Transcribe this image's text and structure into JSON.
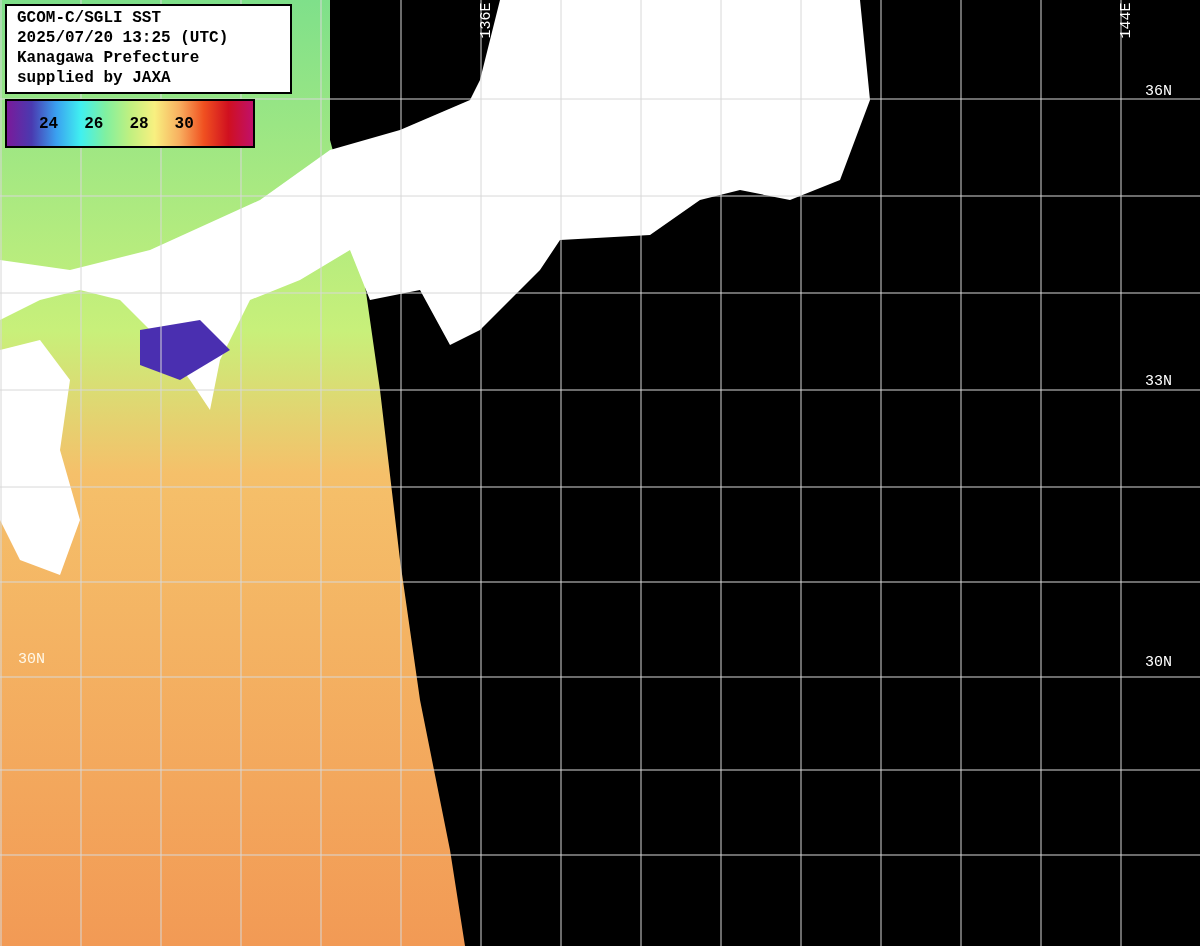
{
  "info_box": {
    "lines": [
      "GCOM-C/SGLI SST",
      "2025/07/20 13:25 (UTC)",
      "Kanagawa Prefecture",
      "supplied by JAXA"
    ]
  },
  "color_scale": {
    "labels": [
      "24",
      "26",
      "28",
      "30"
    ]
  },
  "longitude_labels": [
    {
      "text": "136E"
    },
    {
      "text": "144E"
    }
  ],
  "latitude_labels_right": [
    {
      "text": "36N"
    },
    {
      "text": "33N"
    },
    {
      "text": "30N"
    }
  ],
  "latitude_labels_left": [
    {
      "text": "30N"
    }
  ]
}
